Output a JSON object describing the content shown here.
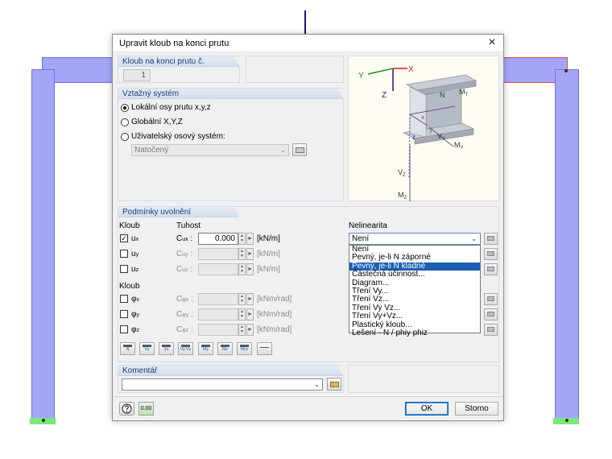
{
  "dialog": {
    "title": "Upravit kloub na konci prutu",
    "close_glyph": "×"
  },
  "member_hinge": {
    "header": "Kloub na konci prutu č.",
    "number": "1"
  },
  "reference_system": {
    "header": "Vztažný systém",
    "options": [
      {
        "label": "Lokální osy prutu x,y,z",
        "selected": true
      },
      {
        "label": "Globální X,Y,Z",
        "selected": false
      },
      {
        "label": "Uživatelský osový systém:",
        "selected": false
      }
    ],
    "user_system_value": "Natočený"
  },
  "release": {
    "header": "Podmínky uvolnění",
    "col_hinge": "Kloub",
    "col_stiffness": "Tuhost",
    "col_nonlinearity": "Nelinearita",
    "col_hinge2": "Kloub",
    "translational": [
      {
        "sym": "u",
        "sub": "x",
        "checked": true,
        "c": "C",
        "csub": "ux",
        "value": "0.000",
        "unit": "[kN/m]",
        "active": true
      },
      {
        "sym": "u",
        "sub": "y",
        "checked": false,
        "c": "C",
        "csub": "uy",
        "value": "",
        "unit": "[kN/m]",
        "active": false
      },
      {
        "sym": "u",
        "sub": "z",
        "checked": false,
        "c": "C",
        "csub": "uz",
        "value": "",
        "unit": "[kN/m]",
        "active": false
      }
    ],
    "rotational": [
      {
        "sym": "φ",
        "sub": "x",
        "checked": false,
        "c": "C",
        "csub": "φx",
        "value": "",
        "unit": "[kNm/rad]"
      },
      {
        "sym": "φ",
        "sub": "y",
        "checked": false,
        "c": "C",
        "csub": "φy",
        "value": "",
        "unit": "[kNm/rad]"
      },
      {
        "sym": "φ",
        "sub": "z",
        "checked": false,
        "c": "C",
        "csub": "φz",
        "value": "",
        "unit": "[kNm/rad]"
      }
    ],
    "nonlinearity_selected": "Není",
    "nonlinearity_options": [
      "Není",
      "Pevný, je-li N záporné",
      "Pevný, je-li N kladné",
      "Částečná účinnost...",
      "Diagram...",
      "Tření Vy...",
      "Tření Vz...",
      "Tření Vy Vz...",
      "Tření Vy+Vz...",
      "Plastický kloub...",
      "Lešení - N / phiy phiz"
    ],
    "highlighted_option_index": 2,
    "colon": ":",
    "spin_glyphs": {
      "up": "▲",
      "down": "▼",
      "right": "▸"
    },
    "toolbar": [
      {
        "name": "N",
        "label": "N"
      },
      {
        "name": "Vy",
        "label": "Vy"
      },
      {
        "name": "Vz",
        "label": "Vz"
      },
      {
        "name": "Vy-Vz",
        "label": "Vy-Vz"
      },
      {
        "name": "My",
        "label": "My"
      },
      {
        "name": "Mz",
        "label": "Mz"
      },
      {
        "name": "Myz",
        "label": "Myz"
      },
      {
        "name": "reset",
        "label": ""
      }
    ]
  },
  "comment": {
    "header": "Komentář",
    "value": ""
  },
  "diagram_labels": {
    "x": "X",
    "y": "Y",
    "z": "Z",
    "N": "N",
    "Mt": "M",
    "Mt_sub": "T",
    "Vy": "V",
    "Vy_sub": "Y",
    "My": "M",
    "My_sub": "Y",
    "Vz": "V",
    "Vz_sub": "Z",
    "Mz": "M",
    "Mz_sub": "Z",
    "lx": "x",
    "ly": "y",
    "lz": "z"
  },
  "buttons": {
    "ok": "OK",
    "cancel": "Storno",
    "units_label": "0.00"
  },
  "arrow_glyph": "⌄",
  "colors": {
    "accent": "#1a5fb4",
    "member_fill": "#a3a6f7",
    "support": "#79e87d"
  }
}
